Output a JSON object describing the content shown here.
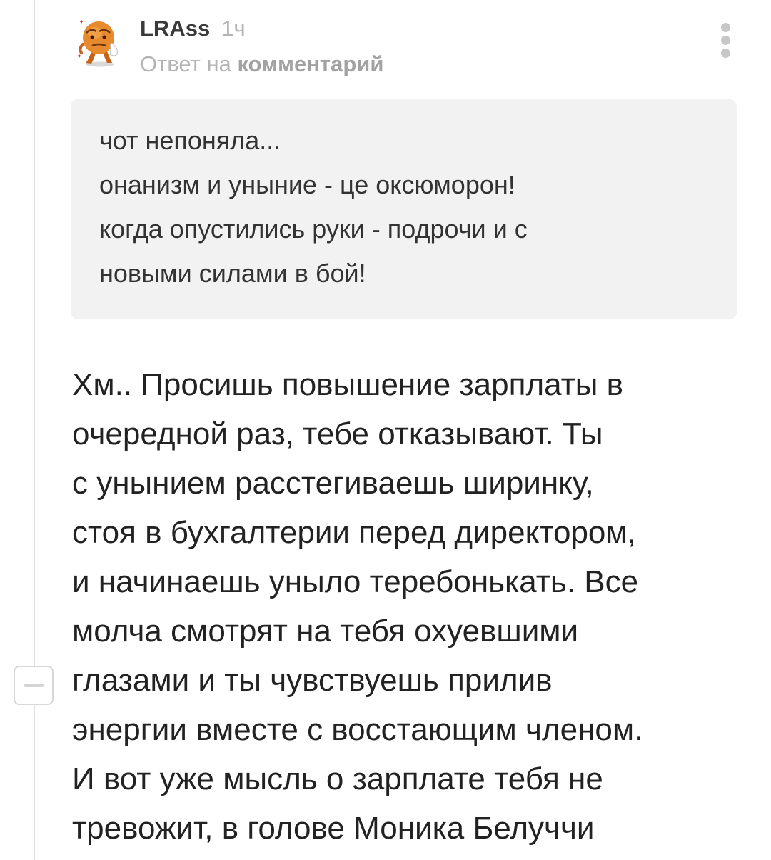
{
  "comment": {
    "author": "LRAss",
    "time": "1ч",
    "reply_prefix": "Ответ на",
    "reply_link": "комментарий",
    "avatar_icon": "orange-cartoon-character-avatar",
    "more_icon": "more-vertical-icon",
    "collapse_icon": "minus-icon",
    "quote_lines": [
      "чот непоняла...",
      "онанизм и уныние - це оксюморон!",
      "когда опустились руки - подрочи и с",
      "новыми силами в бой!"
    ],
    "body_lines": [
      "Хм.. Просишь повышение зарплаты в",
      "очередной раз, тебе отказывают. Ты",
      "с унынием расстегиваешь ширинку,",
      "стоя в бухгалтерии перед директором,",
      "и начинаешь уныло теребонькать. Все",
      "молча смотрят на тебя охуевшими",
      "глазами и ты чувствуешь прилив",
      "энергии вместе с восстающим членом.",
      "И вот уже мысль о зарплате тебя не",
      "тревожит, в голове Моника Белуччи"
    ]
  },
  "colors": {
    "quote_background": "#f2f2f2",
    "meta_text": "#b4b4b4",
    "thread_line": "#e1e1e1"
  }
}
